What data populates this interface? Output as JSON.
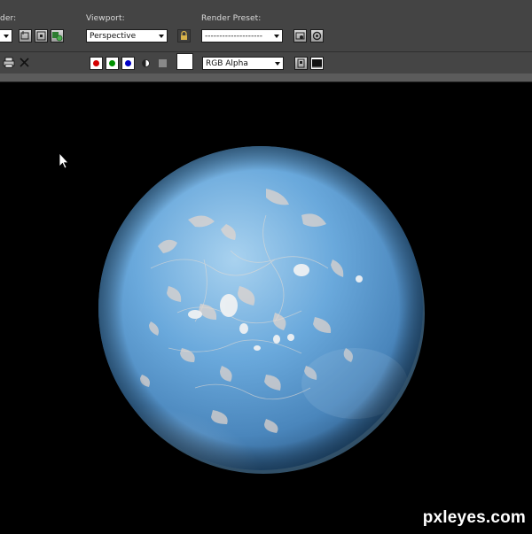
{
  "toolbar": {
    "area_label_truncated": "der:",
    "viewport_label": "Viewport:",
    "viewport_value": "Perspective",
    "preset_label": "Render Preset:",
    "preset_value": "--------------------",
    "channel_value": "RGB Alpha",
    "channels": [
      {
        "name": "red",
        "color": "#d40000"
      },
      {
        "name": "green",
        "color": "#009000"
      },
      {
        "name": "blue",
        "color": "#0000c8"
      }
    ]
  },
  "viewport": {
    "background": "#000000",
    "object": "planet-sphere",
    "planet_base_color": "#5d9fd6",
    "planet_highlight_color": "#a9d2ef"
  },
  "watermark": "pxleyes.com"
}
